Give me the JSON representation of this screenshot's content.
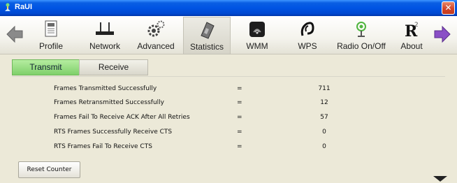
{
  "window": {
    "title": "RaUI",
    "close_symbol": "✕"
  },
  "toolbar": {
    "items": [
      {
        "label": "Profile",
        "icon": "profile-document-icon"
      },
      {
        "label": "Network",
        "icon": "router-icon"
      },
      {
        "label": "Advanced",
        "icon": "gears-icon"
      },
      {
        "label": "Statistics",
        "icon": "calculator-icon",
        "active": true
      },
      {
        "label": "WMM",
        "icon": "wmm-icon"
      },
      {
        "label": "WPS",
        "icon": "wps-icon"
      },
      {
        "label": "Radio On/Off",
        "icon": "radio-icon"
      },
      {
        "label": "About",
        "icon": "about-r-icon"
      }
    ],
    "back_icon": "arrow-left-icon",
    "forward_icon": "arrow-right-icon"
  },
  "tabs": {
    "transmit": "Transmit",
    "receive": "Receive",
    "active": "Transmit"
  },
  "stats": [
    {
      "label": "Frames Transmitted Successfully",
      "eq": "=",
      "value": "711"
    },
    {
      "label": "Frames Retransmitted Successfully",
      "eq": "=",
      "value": "12"
    },
    {
      "label": "Frames Fail To Receive ACK After All Retries",
      "eq": "=",
      "value": "57"
    },
    {
      "label": "RTS Frames Successfully Receive CTS",
      "eq": "=",
      "value": "0"
    },
    {
      "label": "RTS Frames Fail To Receive CTS",
      "eq": "=",
      "value": "0"
    }
  ],
  "reset_button": "Reset Counter",
  "colors": {
    "title_blue": "#0054e3",
    "active_tab": "#7fd06a",
    "background": "#ece9d8"
  }
}
